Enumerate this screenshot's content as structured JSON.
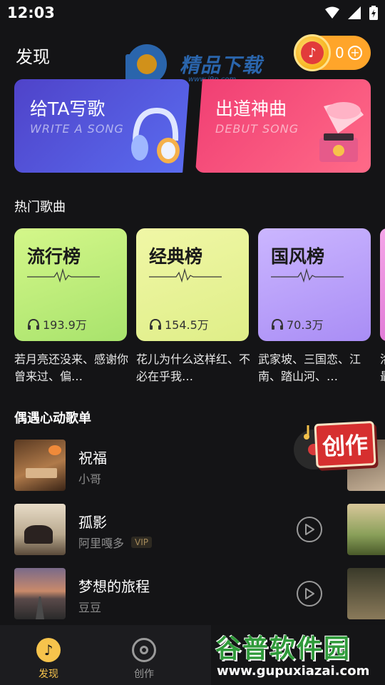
{
  "status_bar": {
    "time": "12:03"
  },
  "header": {
    "title": "发现",
    "watermark_text": "精品下载",
    "watermark_url": "www.j9p.com",
    "coins": "0"
  },
  "feature_cards": [
    {
      "title": "给TA写歌",
      "subtitle": "WRITE A SONG"
    },
    {
      "title": "出道神曲",
      "subtitle": "DEBUT SONG"
    }
  ],
  "hot_songs": {
    "title": "热门歌曲",
    "charts": [
      {
        "name": "流行榜",
        "plays": "193.9万",
        "desc": "若月亮还没来、感谢你曾来过、偏…"
      },
      {
        "name": "经典榜",
        "plays": "154.5万",
        "desc": "花儿为什么这样红、不必在乎我…"
      },
      {
        "name": "国风榜",
        "plays": "70.3万",
        "desc": "武家坡、三国恋、江南、踏山河、…"
      }
    ],
    "partial_desc": "洛\n最"
  },
  "playlist": {
    "title": "偶遇心动歌单",
    "songs": [
      {
        "title": "祝福",
        "artist": "小哥",
        "vip": ""
      },
      {
        "title": "孤影",
        "artist": "阿里嘎多",
        "vip": "VIP"
      },
      {
        "title": "梦想的旅程",
        "artist": "豆豆",
        "vip": ""
      }
    ],
    "create_badge": "创作"
  },
  "bottom_nav": {
    "items": [
      {
        "label": "发现"
      },
      {
        "label": "创作"
      }
    ]
  },
  "watermark_bottom": {
    "title": "谷普软件园",
    "url": "www.gupuxiazai.com"
  },
  "colors": {
    "accent": "#f6c34c",
    "coin": "#ffa52a"
  }
}
